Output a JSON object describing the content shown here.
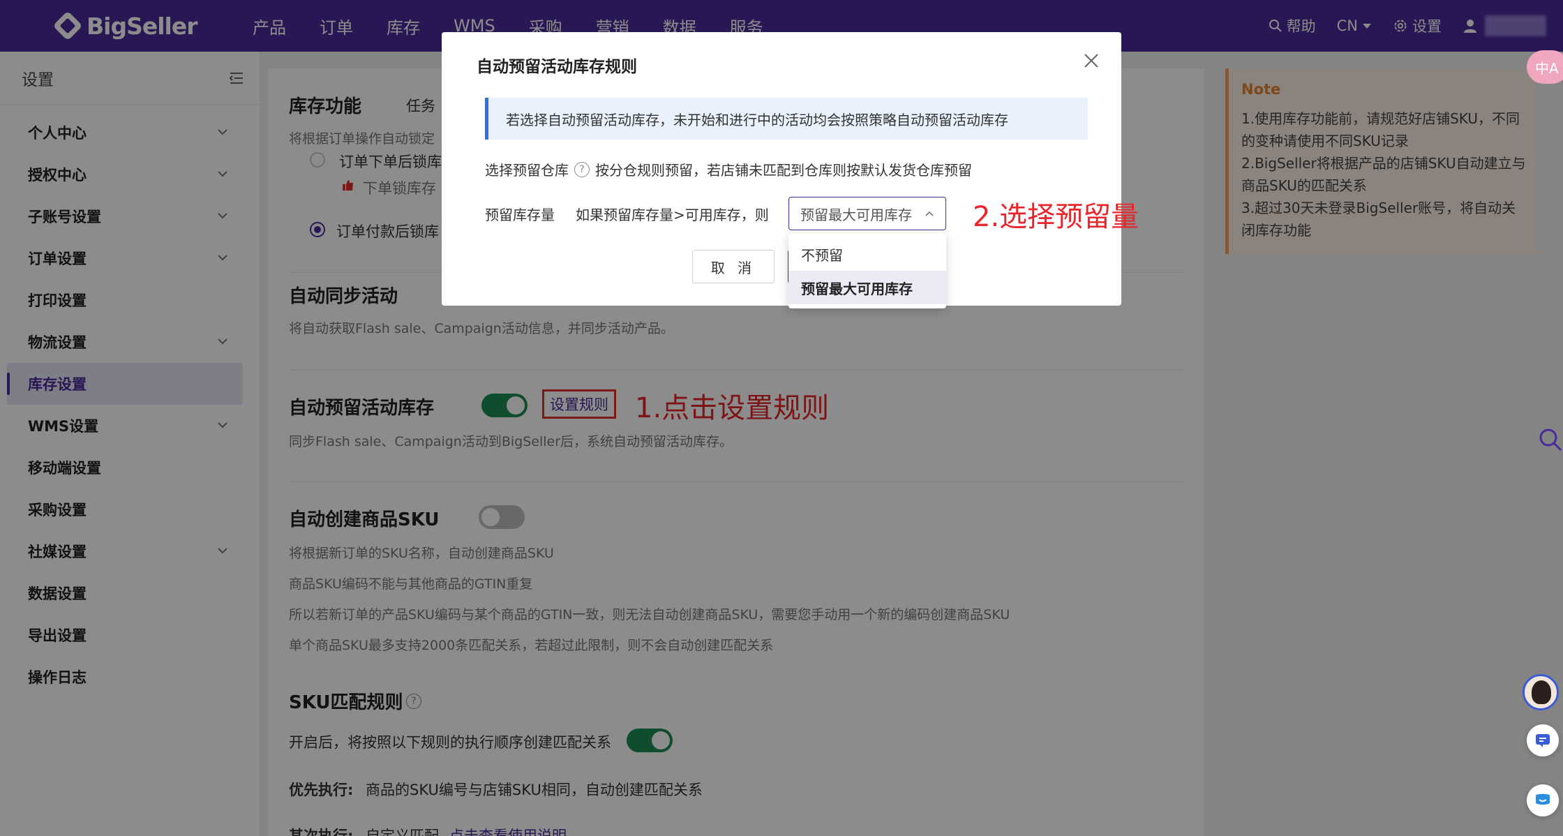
{
  "brand": {
    "name": "BigSeller"
  },
  "nav": {
    "items": [
      "产品",
      "订单",
      "库存",
      "WMS",
      "采购",
      "营销",
      "数据",
      "服务"
    ]
  },
  "top_right": {
    "help": "帮助",
    "lang": "CN",
    "settings": "设置"
  },
  "sidebar": {
    "title": "设置",
    "items": [
      {
        "label": "个人中心",
        "has_children": true
      },
      {
        "label": "授权中心",
        "has_children": true
      },
      {
        "label": "子账号设置",
        "has_children": true
      },
      {
        "label": "订单设置",
        "has_children": true
      },
      {
        "label": "打印设置",
        "has_children": false
      },
      {
        "label": "物流设置",
        "has_children": true
      },
      {
        "label": "库存设置",
        "has_children": false,
        "active": true
      },
      {
        "label": "WMS设置",
        "has_children": true
      },
      {
        "label": "移动端设置",
        "has_children": false
      },
      {
        "label": "采购设置",
        "has_children": false
      },
      {
        "label": "社媒设置",
        "has_children": true
      },
      {
        "label": "数据设置",
        "has_children": false
      },
      {
        "label": "导出设置",
        "has_children": false
      },
      {
        "label": "操作日志",
        "has_children": false
      }
    ]
  },
  "main": {
    "inventory": {
      "title": "库存功能",
      "tab": "任务",
      "desc": "将根据订单操作自动锁定",
      "opt1": "订单下单后锁库",
      "opt1_sub": "下单锁库存",
      "opt2": "订单付款后锁库"
    },
    "sync": {
      "title": "自动同步活动",
      "desc": "将自动获取Flash sale、Campaign活动信息，并同步活动产品。"
    },
    "reserve": {
      "title": "自动预留活动库存",
      "enabled": true,
      "rule_button": "设置规则",
      "desc": "同步Flash sale、Campaign活动到BigSeller后，系统自动预留活动库存。"
    },
    "auto_sku": {
      "title": "自动创建商品SKU",
      "enabled": false,
      "lines": [
        "将根据新订单的SKU名称，自动创建商品SKU",
        "商品SKU编码不能与其他商品的GTIN重复",
        "所以若新订单的产品SKU编码与某个商品的GTIN一致，则无法自动创建商品SKU，需要您手动用一个新的编码创建商品SKU",
        "单个商品SKU最多支持2000条匹配关系，若超过此限制，则不会自动创建匹配关系"
      ]
    },
    "sku_match": {
      "title": "SKU匹配规则",
      "toggle_label": "开启后，将按照以下规则的执行顺序创建匹配关系",
      "enabled": true,
      "priority_label": "优先执行:",
      "priority_text": "商品的SKU编号与店铺SKU相同，自动创建匹配关系",
      "second_label": "其次执行:",
      "second_text": "自定义匹配",
      "second_link": "点击查看使用说明"
    }
  },
  "note": {
    "title": "Note",
    "lines": [
      "1.使用库存功能前，请规范好店铺SKU，不同",
      "的变种请使用不同SKU记录",
      "2.BigSeller将根据产品的店铺SKU自动建立与",
      "商品SKU的匹配关系",
      "3.超过30天未登录BigSeller账号，将自动关",
      "闭库存功能"
    ]
  },
  "annotations": {
    "step1": "1.点击设置规则",
    "step2": "2.选择预留量"
  },
  "modal": {
    "title": "自动预留活动库存规则",
    "info": "若选择自动预留活动库存，未开始和进行中的活动均会按照策略自动预留活动库存",
    "warehouse_label": "选择预留仓库",
    "warehouse_text": "按分仓规则预留，若店铺未匹配到仓库则按默认发货仓库预留",
    "qty_label": "预留库存量",
    "qty_condition": "如果预留库存量>可用库存，则",
    "select_value": "预留最大可用库存",
    "options": [
      "不预留",
      "预留最大可用库存"
    ],
    "cancel": "取 消"
  },
  "widgets": {
    "translate": "中A"
  }
}
